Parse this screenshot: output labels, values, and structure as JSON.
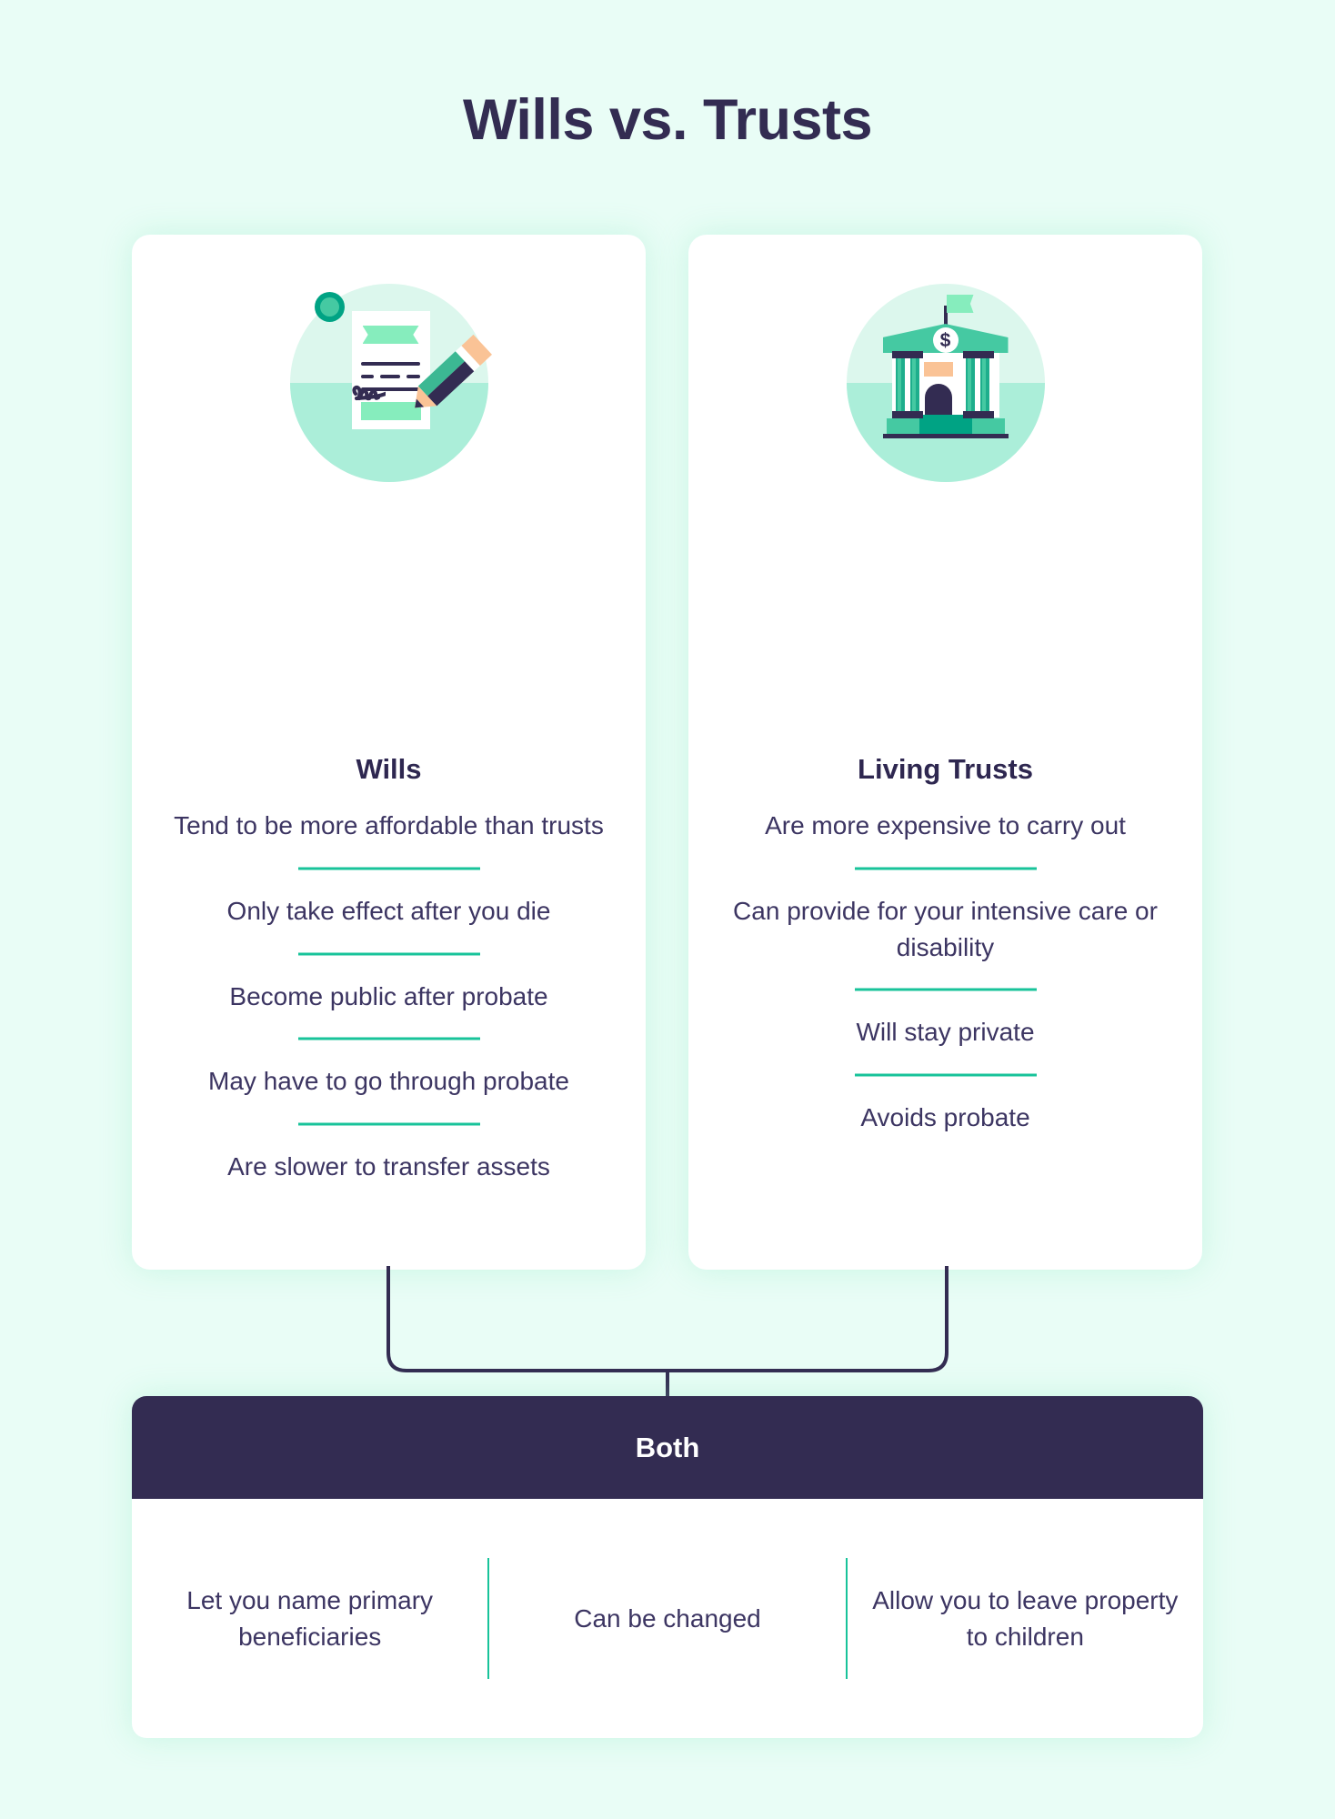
{
  "title": "Wills vs. Trusts",
  "theme": {
    "background": "#e9fdf6",
    "card_background": "#ffffff",
    "heading_color": "#332c52",
    "text_color": "#3c3562",
    "accent_green": "#18c39a",
    "accent_mint": "#86edbd",
    "dark_navy": "#332c52",
    "peach": "#fac396"
  },
  "columns": [
    {
      "icon": "will-document-pencil-icon",
      "heading": "Wills",
      "items": [
        "Tend to be more affordable than trusts",
        "Only take effect after you die",
        "Become public after probate",
        "May have to go through probate",
        "Are slower to transfer assets"
      ]
    },
    {
      "icon": "bank-building-icon",
      "heading": "Living Trusts",
      "items": [
        "Are more expensive to carry out",
        "Can provide for your intensive care or disability",
        "Will stay private",
        "Avoids probate"
      ]
    }
  ],
  "both": {
    "header": "Both",
    "items": [
      "Let you name primary beneficiaries",
      "Can be changed",
      "Allow you to leave property to children"
    ]
  },
  "icons": {
    "dollar_symbol": "$"
  }
}
